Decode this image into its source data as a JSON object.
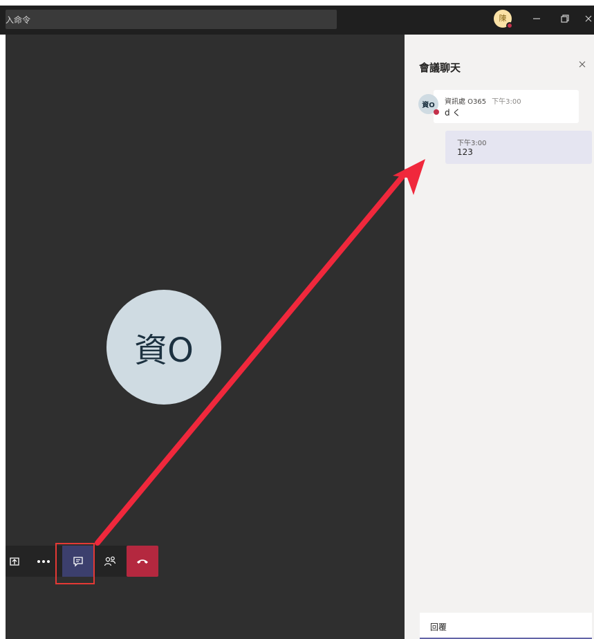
{
  "titlebar": {
    "search_text": "入命令",
    "user_avatar": "陳",
    "icons": [
      "minimize-icon",
      "restore-icon",
      "close-icon"
    ],
    "colors": {
      "presence_busy": "#c4314b"
    }
  },
  "stage": {
    "participant_initials": "資O"
  },
  "call_controls": {
    "icons": [
      "share-screen-icon",
      "more-options-icon",
      "chat-icon",
      "participants-icon",
      "hang-up-icon"
    ],
    "active": "chat-icon",
    "colors": {
      "active": "#3c3f6d",
      "hangup": "#b4283f"
    }
  },
  "chat_panel": {
    "title": "會議聊天",
    "messages": [
      {
        "avatar": "資O",
        "author": "資訊處 O365",
        "time": "下午3:00",
        "text": "d く"
      },
      {
        "time": "下午3:00",
        "text": "123"
      }
    ],
    "reply_placeholder": "回覆"
  },
  "annotation": {
    "color": "#e53935"
  }
}
